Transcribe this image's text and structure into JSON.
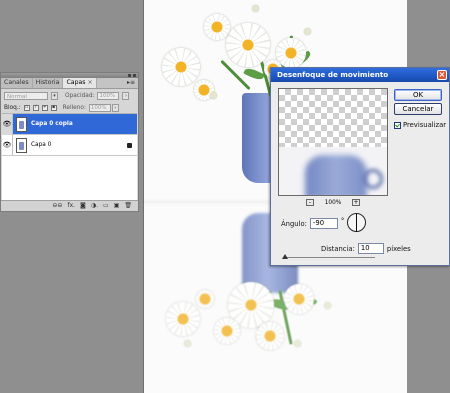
{
  "layers_panel": {
    "tabs": [
      "Canales",
      "Historia",
      "Capas"
    ],
    "active_tab": "Capas",
    "blend_mode": "Normal",
    "opacity_label": "Opacidad:",
    "opacity_value": "100%",
    "lock_label": "Bloq.:",
    "fill_label": "Relleno:",
    "fill_value": "100%",
    "layers": [
      {
        "name": "Capa 0 copia",
        "selected": true,
        "visible": true
      },
      {
        "name": "Capa 0",
        "selected": false,
        "visible": true,
        "locked": true
      }
    ],
    "bottom_icons": [
      "link-icon",
      "fx-icon",
      "mask-icon",
      "adjustment-icon",
      "group-icon",
      "new-layer-icon",
      "trash-icon"
    ],
    "bottom_text": {
      "link": "⊖⊖",
      "fx": "fx."
    }
  },
  "dialog": {
    "title": "Desenfoque de movimiento",
    "ok_label": "OK",
    "cancel_label": "Cancelar",
    "preview_label": "Previsualizar",
    "preview_checked": true,
    "zoom_value": "100%",
    "zoom_minus": "-",
    "zoom_plus": "+",
    "angle_label": "Ángulo:",
    "angle_value": "-90",
    "angle_unit": "°",
    "distance_label": "Distancia:",
    "distance_value": "10",
    "distance_unit": "píxeles",
    "close_symbol": "×"
  },
  "colors": {
    "dialog_title": "#1f57c4",
    "selected_layer": "#3168d8",
    "cup": "#6e84c4",
    "close_button": "#d65a35"
  }
}
